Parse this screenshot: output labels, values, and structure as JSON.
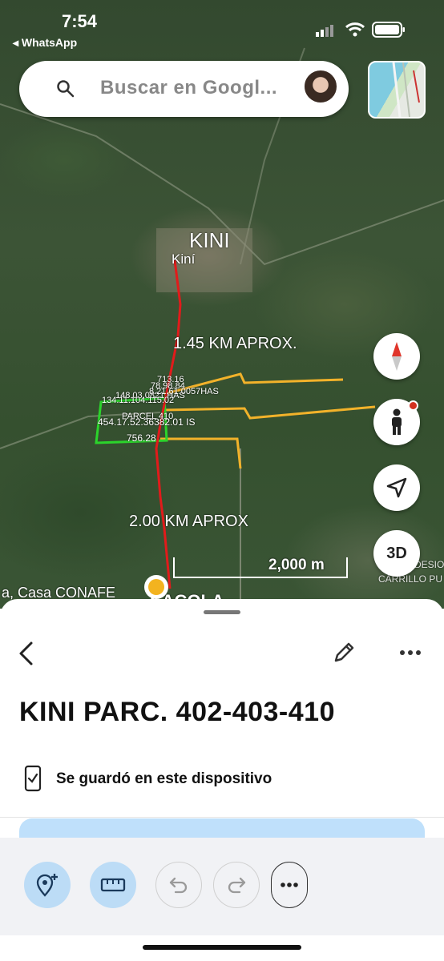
{
  "status_bar": {
    "time": "7:54",
    "back_app": "◂ WhatsApp"
  },
  "search": {
    "placeholder": "Buscar en Googl..."
  },
  "map": {
    "labels": {
      "town_big": "KINI",
      "town_small": "Kiní",
      "dist1": "1.45 KM APROX.",
      "dist2": "2.00 KM APROX",
      "parcel_a": "713.16",
      "parcel_b": "78.98.84",
      "parcel_c": "148.03.0821 HAS",
      "parcel_d": "8.21.61.0057HAS",
      "parcel_e": "134.11.104.115.02",
      "parcel_f": "PARCEL 410",
      "parcel_g": "454.17.52.36382.01 IS",
      "parcel_h": "756.28",
      "place_left": "a, Casa CONAFE",
      "place_bottom": "SACOLA",
      "place_right1": "DESIO",
      "place_right2": "CARRILLO PU"
    },
    "scale_label": "2,000 m",
    "buttons": {
      "three_d": "3D"
    }
  },
  "sheet": {
    "title": "KINI PARC. 402-403-410",
    "saved_text": "Se guardó en este dispositivo"
  },
  "colors": {
    "route_red": "#e11b1b",
    "boundary_yellow": "#f2b22a",
    "parcel_green": "#2bd42b",
    "tool_blue": "#bcdcf6"
  }
}
